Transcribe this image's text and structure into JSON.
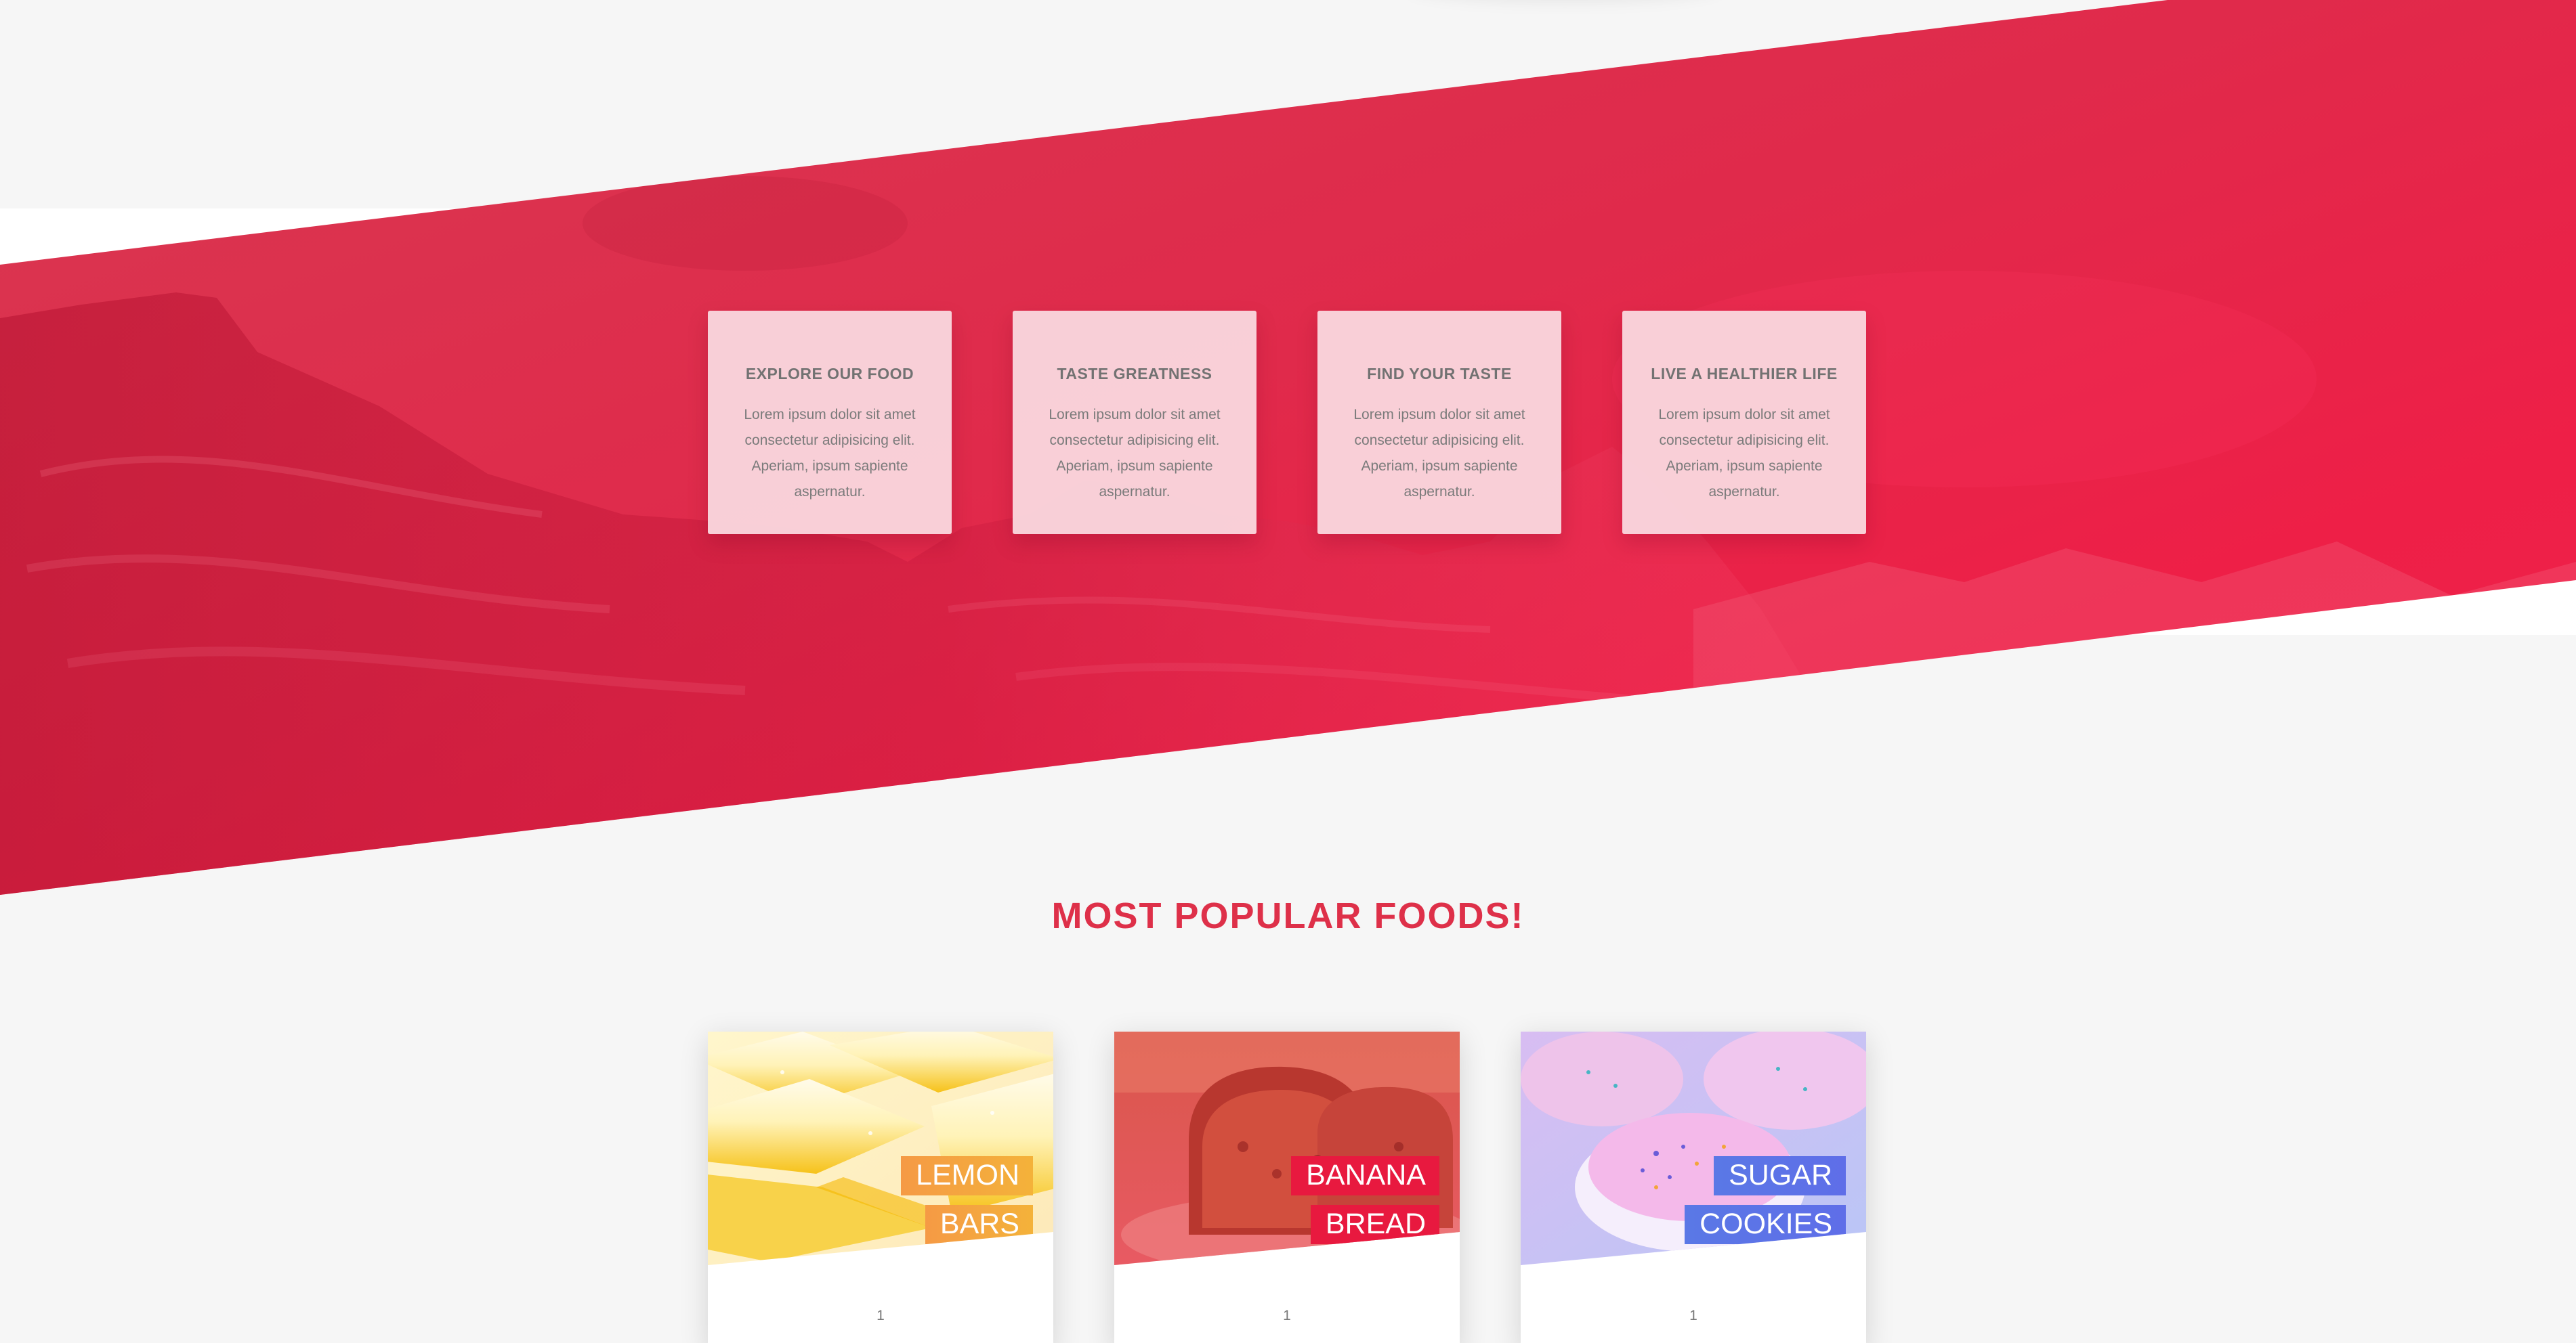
{
  "features": [
    {
      "title": "EXPLORE OUR FOOD",
      "text": "Lorem ipsum dolor sit amet consectetur adipisicing elit. Aperiam, ipsum sapiente aspernatur."
    },
    {
      "title": "TASTE GREATNESS",
      "text": "Lorem ipsum dolor sit amet consectetur adipisicing elit. Aperiam, ipsum sapiente aspernatur."
    },
    {
      "title": "FIND YOUR TASTE",
      "text": "Lorem ipsum dolor sit amet consectetur adipisicing elit. Aperiam, ipsum sapiente aspernatur."
    },
    {
      "title": "LIVE A HEALTHIER LIFE",
      "text": "Lorem ipsum dolor sit amet consectetur adipisicing elit. Aperiam, ipsum sapiente aspernatur."
    }
  ],
  "popular": {
    "title": "MOST POPULAR FOODS!",
    "foods": [
      {
        "name": "LEMON BARS",
        "number": "1",
        "image": "lemon-bars-photo",
        "label_color": "#f49a3a"
      },
      {
        "name": "BANANA BREAD",
        "number": "1",
        "image": "banana-bread-photo",
        "label_color": "#e8193f"
      },
      {
        "name": "SUGAR COOKIES",
        "number": "1",
        "image": "sugar-cookies-photo",
        "label_color": "#4f7fe6"
      }
    ]
  },
  "colors": {
    "accent": "#de3049",
    "hero_start": "#d83851",
    "hero_end": "#f0224a",
    "background": "#f6f6f6"
  }
}
